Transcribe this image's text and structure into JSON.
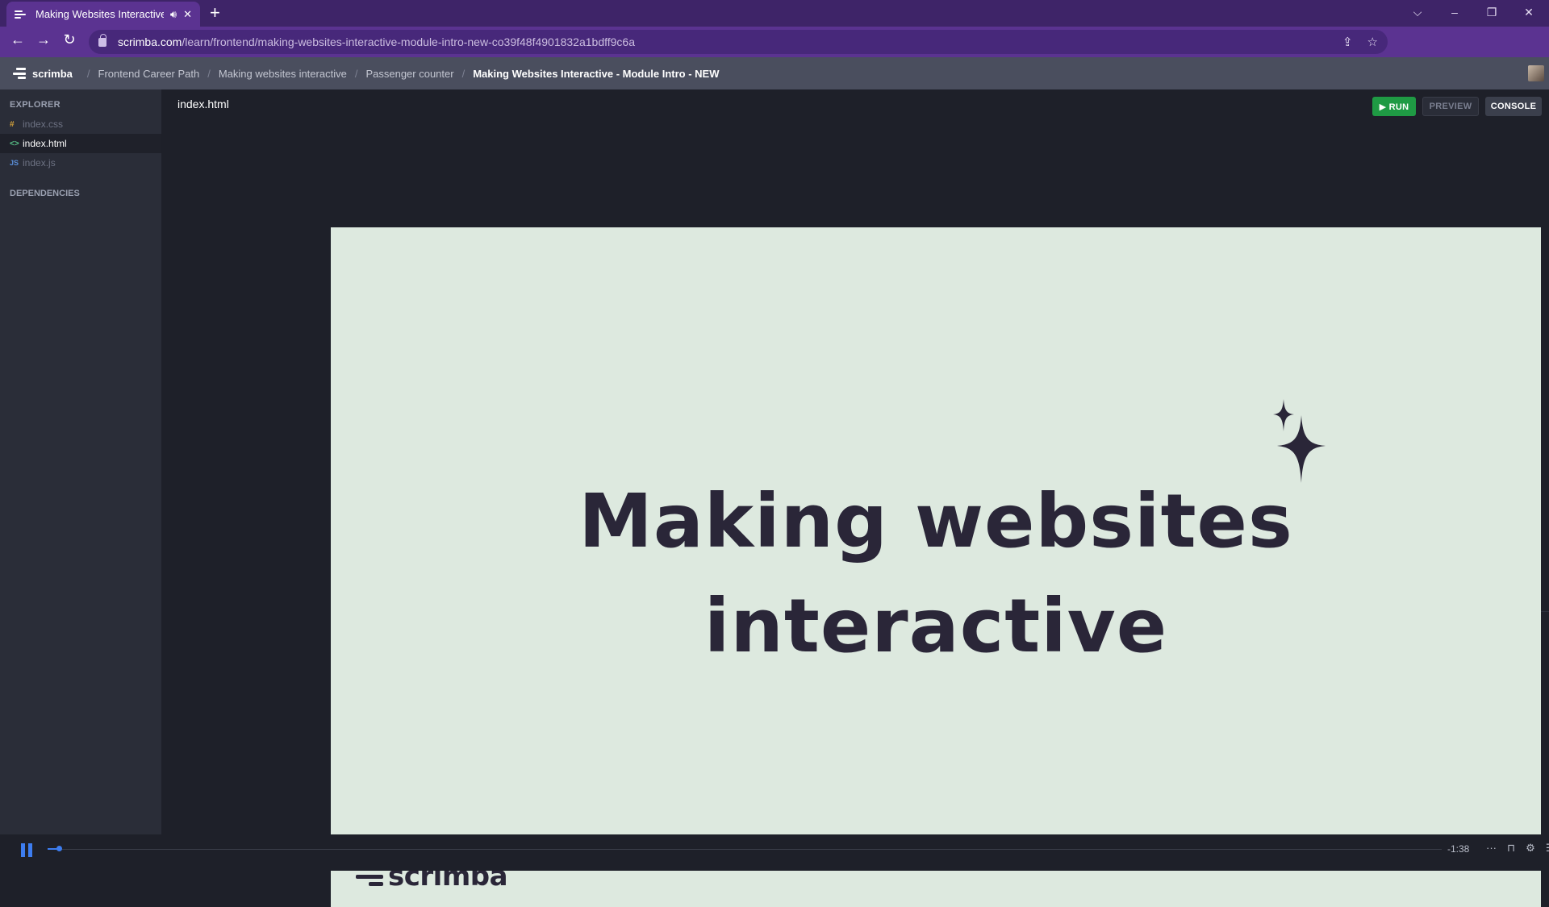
{
  "browser": {
    "tab_title": "Making Websites Interactive",
    "new_tab_symbol": "+",
    "url_host": "scrimba.com",
    "url_path": "/learn/frontend/making-websites-interactive-module-intro-new-co39f48f4901832a1bdff9c6a",
    "window_controls": {
      "tab_search": "⌵",
      "minimize": "–",
      "restore": "❐",
      "close": "✕"
    },
    "nav": {
      "back": "←",
      "forward": "→",
      "reload": "↻"
    },
    "url_icons": {
      "share": "⇪",
      "bookmark": "☆"
    },
    "extensions": {
      "puzzle": "✦",
      "media": "≡",
      "sidepanel": "▮",
      "menu": "⋮"
    }
  },
  "header": {
    "brand": "scrimba",
    "breadcrumbs": [
      "Frontend Career Path",
      "Making websites interactive",
      "Passenger counter"
    ],
    "current": "Making Websites Interactive - Module Intro - NEW"
  },
  "sidebar": {
    "explorer_label": "EXPLORER",
    "files": [
      {
        "icon": "#",
        "name": "index.css"
      },
      {
        "icon": "<>",
        "name": "index.html"
      },
      {
        "icon": "JS",
        "name": "index.js"
      }
    ],
    "dependencies_label": "DEPENDENCIES"
  },
  "editor": {
    "file_title": "index.html",
    "run_label": "▶ RUN",
    "preview_label": "PREVIEW",
    "console_label": "CONSOLE",
    "collapse_icon": "⌄"
  },
  "slide": {
    "title_line1": "Making websites",
    "title_line2": "interactive",
    "logo_text": "scrimba"
  },
  "player": {
    "progress_fraction": 0.008,
    "time_remaining": "-1:38",
    "more_icon": "···",
    "bookmark_icon": "⊓",
    "settings_icon": "⚙",
    "list_icon": "☰"
  },
  "colors": {
    "tab_bar": "#3e2468",
    "address_bar": "#5b3391",
    "app_bar": "#4a4e5e",
    "slide_bg": "#dde9df",
    "slide_text": "#2a2638",
    "run_green": "#1f9a44",
    "accent_blue": "#3d7df0"
  }
}
